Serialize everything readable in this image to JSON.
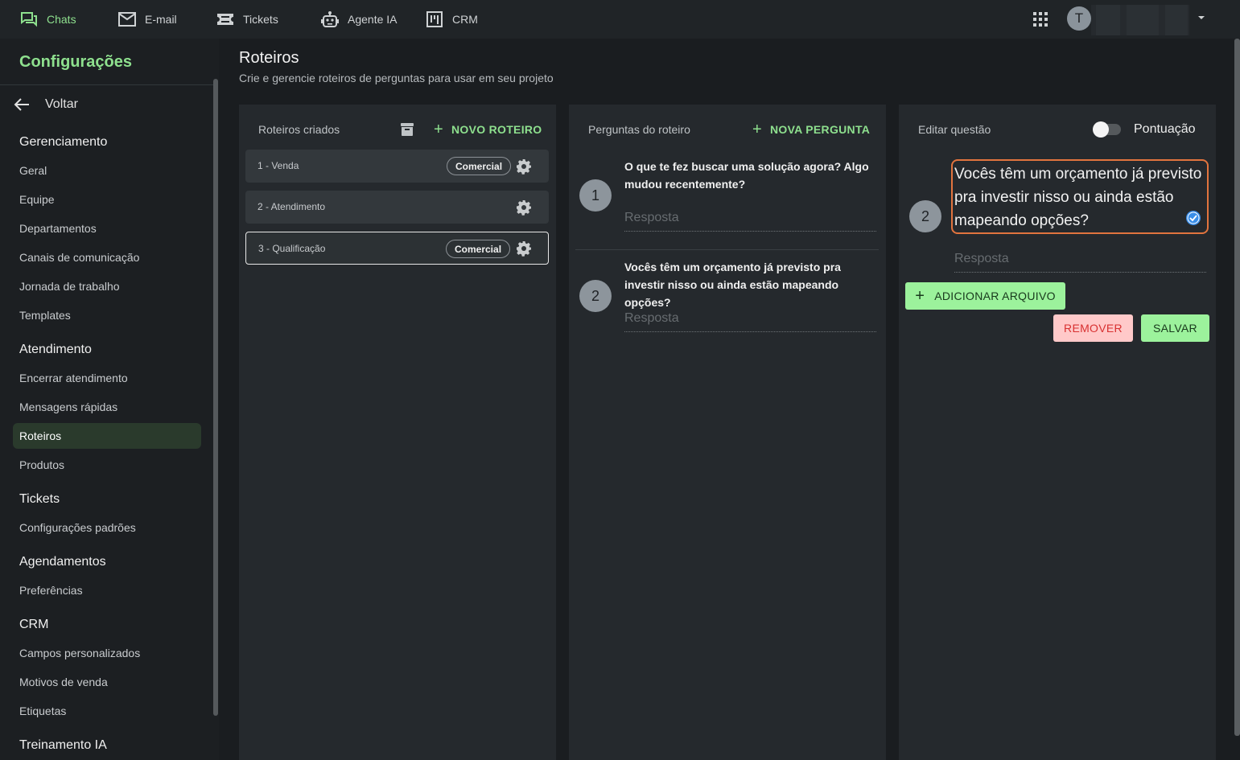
{
  "topnav": {
    "items": [
      {
        "label": "Chats",
        "icon": "chat-icon",
        "active": true
      },
      {
        "label": "E-mail",
        "icon": "mail-icon"
      },
      {
        "label": "Tickets",
        "icon": "ticket-icon"
      },
      {
        "label": "Agente IA",
        "icon": "robot-icon"
      },
      {
        "label": "CRM",
        "icon": "kanban-icon"
      }
    ],
    "avatar_initial": "T"
  },
  "sidebar": {
    "title": "Configurações",
    "back_label": "Voltar",
    "sections": [
      {
        "heading": "Gerenciamento",
        "items": [
          "Geral",
          "Equipe",
          "Departamentos",
          "Canais de comunicação",
          "Jornada de trabalho",
          "Templates"
        ]
      },
      {
        "heading": "Atendimento",
        "items": [
          "Encerrar atendimento",
          "Mensagens rápidas",
          "Roteiros",
          "Produtos"
        ]
      },
      {
        "heading": "Tickets",
        "items": [
          "Configurações padrões"
        ]
      },
      {
        "heading": "Agendamentos",
        "items": [
          "Preferências"
        ]
      },
      {
        "heading": "CRM",
        "items": [
          "Campos personalizados",
          "Motivos de venda",
          "Etiquetas"
        ]
      },
      {
        "heading": "Treinamento IA",
        "items": []
      }
    ],
    "selected_item": "Roteiros"
  },
  "page": {
    "title": "Roteiros",
    "subtitle": "Crie e gerencie roteiros de perguntas para usar em seu projeto"
  },
  "scripts_panel": {
    "heading": "Roteiros criados",
    "new_button": "NOVO ROTEIRO",
    "items": [
      {
        "name": "1 - Venda",
        "tag": "Comercial"
      },
      {
        "name": "2 - Atendimento",
        "tag": ""
      },
      {
        "name": "3 - Qualificação",
        "tag": "Comercial",
        "selected": true
      }
    ]
  },
  "questions_panel": {
    "heading": "Perguntas do roteiro",
    "new_button": "NOVA PERGUNTA",
    "questions": [
      {
        "number": "1",
        "text": "O que te fez buscar uma solução agora? Algo mudou recentemente?",
        "answer_placeholder": "Resposta"
      },
      {
        "number": "2",
        "text": "Vocês têm um orçamento já previsto pra investir nisso ou ainda estão mapeando opções?",
        "answer_placeholder": "Resposta"
      }
    ]
  },
  "edit_panel": {
    "heading": "Editar questão",
    "toggle_label": "Pontuação",
    "toggle_on": false,
    "question_number": "2",
    "question_text": "Vocês têm um orçamento já previsto pra investir nisso ou ainda estão mapeando opções?",
    "answer_placeholder": "Resposta",
    "add_file_button": "ADICIONAR ARQUIVO",
    "remove_button": "REMOVER",
    "save_button": "SALVAR"
  },
  "colors": {
    "accent": "#8ee08e",
    "panel_bg": "#25292d",
    "edit_border": "#e2743e",
    "remove_bg": "#ffc9c9",
    "remove_text": "#d83131"
  }
}
